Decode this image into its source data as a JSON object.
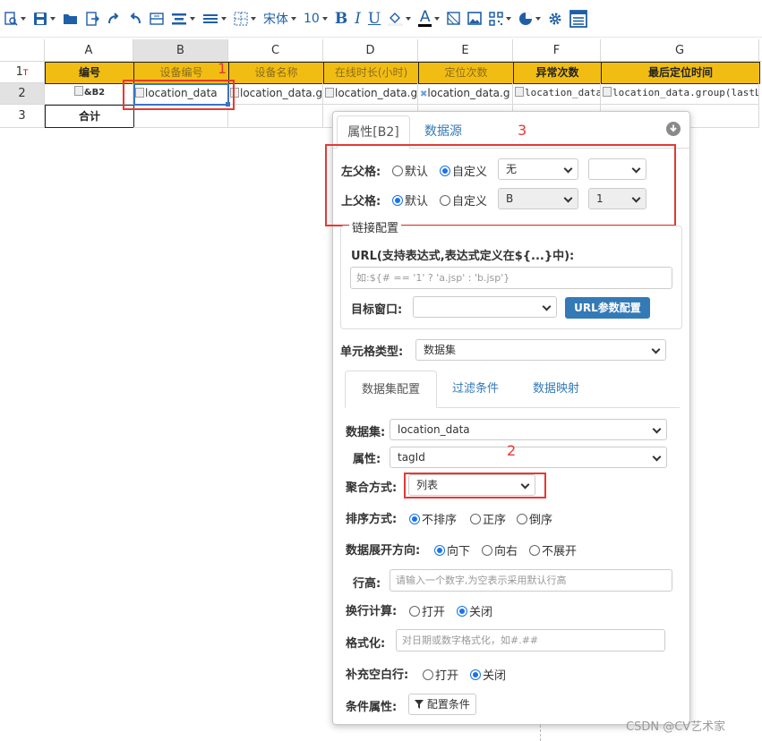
{
  "toolbar": {
    "font_family": "宋体",
    "font_size": "10",
    "bold": "B",
    "italic": "I",
    "underline": "U",
    "font_color": "A"
  },
  "grid": {
    "columns": [
      "A",
      "B",
      "C",
      "D",
      "E",
      "F",
      "G"
    ],
    "row_numbers": [
      "1",
      "2",
      "3"
    ],
    "row1_suffix": "T",
    "header_row": [
      "编号",
      "设备编号",
      "设备名称",
      "在线时长(小时)",
      "定位次数",
      "异常次数",
      "最后定位时间"
    ],
    "data_row": [
      "&B2",
      "location_data",
      "location_data.g",
      "location_data.g",
      "location_data.g",
      "location_data",
      "location_data.group(lastLoc"
    ],
    "total_row_label": "合计"
  },
  "annotations": {
    "n1": "1",
    "n2": "2",
    "n3": "3"
  },
  "dialog": {
    "tabs": [
      "属性[B2]",
      "数据源"
    ],
    "left_parent": {
      "label": "左父格:",
      "opt_default": "默认",
      "opt_custom": "自定义",
      "select1": "无",
      "select2": ""
    },
    "top_parent": {
      "label": "上父格:",
      "opt_default": "默认",
      "opt_custom": "自定义",
      "select1": "B",
      "select2": "1"
    },
    "link_config": {
      "legend": "链接配置",
      "url_label": "URL(支持表达式,表达式定义在${...}中):",
      "url_placeholder": "如:${# == '1' ? 'a.jsp' : 'b.jsp'}",
      "target_label": "目标窗口:",
      "target_value": "",
      "param_button": "URL参数配置"
    },
    "cell_type": {
      "label": "单元格类型:",
      "value": "数据集"
    },
    "subtabs": [
      "数据集配置",
      "过滤条件",
      "数据映射"
    ],
    "dataset": {
      "label": "数据集:",
      "value": "location_data"
    },
    "property": {
      "label": "属性:",
      "value": "tagId"
    },
    "aggregation": {
      "label": "聚合方式:",
      "value": "列表"
    },
    "sort": {
      "label": "排序方式:",
      "options": [
        "不排序",
        "正序",
        "倒序"
      ]
    },
    "expand": {
      "label": "数据展开方向:",
      "options": [
        "向下",
        "向右",
        "不展开"
      ]
    },
    "row_height": {
      "label": "行高:",
      "placeholder": "请输入一个数字,为空表示采用默认行高"
    },
    "wrap_calc": {
      "label": "换行计算:",
      "options": [
        "打开",
        "关闭"
      ]
    },
    "format": {
      "label": "格式化:",
      "placeholder": "对日期或数字格式化，如#.##"
    },
    "fill_blank": {
      "label": "补充空白行:",
      "options": [
        "打开",
        "关闭"
      ]
    },
    "conditional": {
      "label": "条件属性:",
      "button": "配置条件"
    }
  },
  "watermark": "CSDN @CV艺术家",
  "colors": {
    "header_fill": "#f2bd13",
    "accent_blue": "#337ab7",
    "annotation_red": "#e53935"
  }
}
